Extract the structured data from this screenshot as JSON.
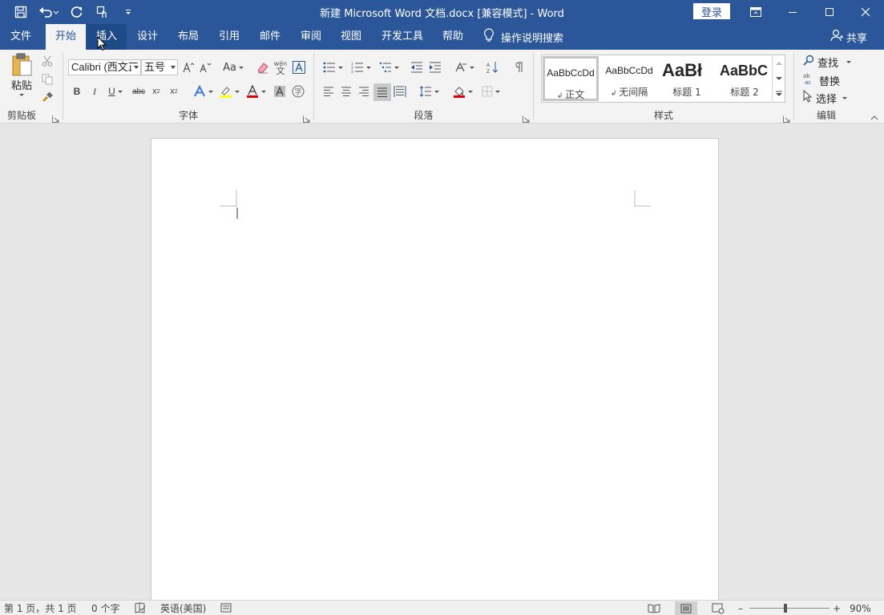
{
  "titlebar": {
    "document_title": "新建 Microsoft Word 文档.docx [兼容模式]  -  Word",
    "login_label": "登录",
    "bg_color": "#2b579a"
  },
  "tabs": [
    {
      "label": "文件"
    },
    {
      "label": "开始"
    },
    {
      "label": "插入"
    },
    {
      "label": "设计"
    },
    {
      "label": "布局"
    },
    {
      "label": "引用"
    },
    {
      "label": "邮件"
    },
    {
      "label": "审阅"
    },
    {
      "label": "视图"
    },
    {
      "label": "开发工具"
    },
    {
      "label": "帮助"
    }
  ],
  "tell_me": {
    "label": "操作说明搜索"
  },
  "share": {
    "label": "共享"
  },
  "ribbon": {
    "clipboard": {
      "paste_label": "粘贴",
      "group_label": "剪贴板"
    },
    "font": {
      "font_name": "Calibri (西文正文",
      "font_size": "五号",
      "change_case_label": "Aa",
      "phonetic_top": "wén",
      "phonetic_bottom": "文",
      "group_label": "字体"
    },
    "paragraph": {
      "group_label": "段落"
    },
    "styles": {
      "group_label": "样式",
      "items": [
        {
          "sample": "AaBbCcDd",
          "name": "正文"
        },
        {
          "sample": "AaBbCcDd",
          "name": "无间隔"
        },
        {
          "sample": "AaBł",
          "name": "标题 1"
        },
        {
          "sample": "AaBbC",
          "name": "标题 2"
        }
      ]
    },
    "editing": {
      "find_label": "查找",
      "replace_label": "替换",
      "select_label": "选择",
      "group_label": "编辑"
    }
  },
  "statusbar": {
    "page_info": "第 1 页，共 1 页",
    "word_count": "0 个字",
    "language": "英语(美国)",
    "zoom_level": "90%"
  }
}
